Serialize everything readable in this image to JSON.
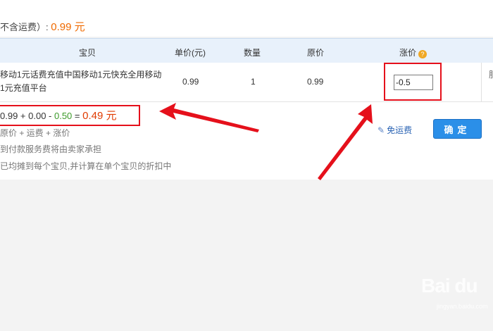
{
  "summary": {
    "label": "不含运费）:",
    "total": "0.99 元"
  },
  "table": {
    "headers": {
      "item": "宝贝",
      "unit_price": "单价(元)",
      "quantity": "数量",
      "original_price": "原价",
      "discount": "涨价"
    },
    "row": {
      "title": "移动1元话费充值中国移动1元快充全用移动1元充值平台",
      "unit_price": "0.99",
      "quantity": "1",
      "original_price": "0.99",
      "discount_value": "-0.5"
    },
    "stub_char": "服"
  },
  "formula": {
    "part1": "0.99 + 0.00 - ",
    "discount": "0.50",
    "part2": " = ",
    "result": "0.49",
    "unit": " 元"
  },
  "notes": [
    "原价 + 运费 + 涨价",
    "到付款服务费将由卖家承担",
    "已均摊到每个宝贝,并计算在单个宝贝的折扣中"
  ],
  "actions": {
    "free_shipping": "免运费",
    "confirm": "确定"
  },
  "watermark": {
    "main": "Bai du",
    "sub": "jingyan.baidu.com"
  },
  "colors": {
    "accent_orange": "#ef6a00",
    "annotation_red": "#e5101b",
    "button_blue": "#2b8fe8",
    "header_blue": "#e8f1fb"
  }
}
